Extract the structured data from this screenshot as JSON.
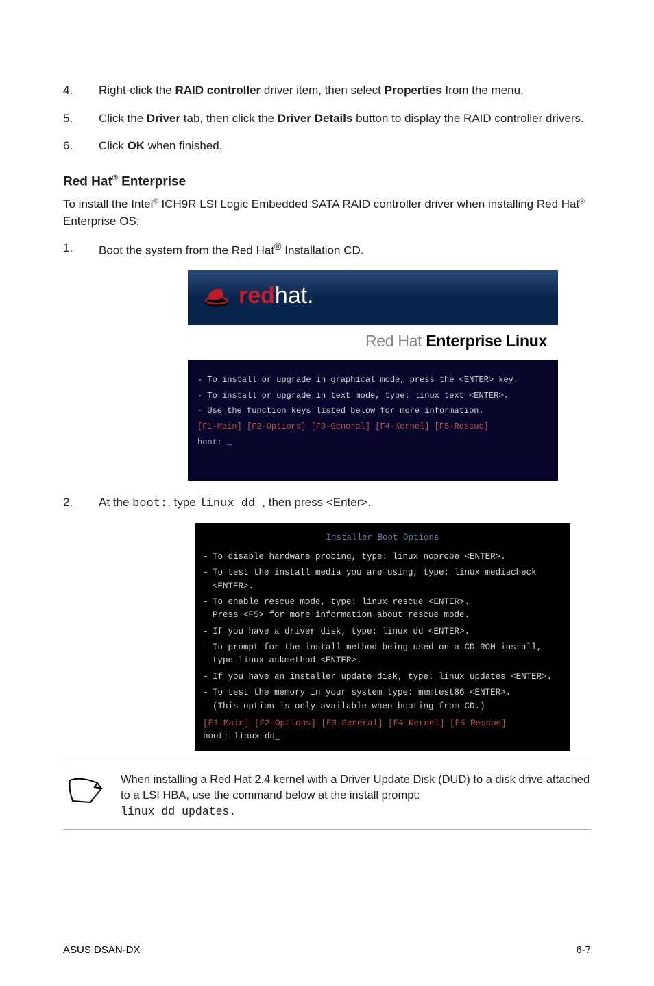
{
  "steps_a": [
    {
      "num": "4.",
      "html": "Right-click the <b>RAID controller</b> driver item, then select <b>Properties</b> from the menu."
    },
    {
      "num": "5.",
      "html": "Click the <b>Driver</b> tab, then click the <b>Driver Details</b> button to display the RAID controller drivers."
    },
    {
      "num": "6.",
      "html": "Click <b>OK</b> when finished."
    }
  ],
  "section_title": {
    "pre": "Red Hat",
    "sup": "®",
    "post": " Enterprise"
  },
  "intro": {
    "line1_pre": "To install the Intel",
    "line1_sup": "®",
    "line1_post": " ICH9R LSI Logic Embedded SATA RAID controller driver when installing Red Hat",
    "line2_sup": "®",
    "line2_post": " Enterprise OS:"
  },
  "steps_b": [
    {
      "num": "1.",
      "pre": "Boot the system from the Red Hat",
      "sup": "®",
      "post": " Installation CD."
    }
  ],
  "shot1": {
    "logo_red": "red",
    "logo_hat": "hat.",
    "subline_grey": "Red Hat ",
    "subline_bold": "Enterprise Linux",
    "console_lines": [
      "-  To install or upgrade in graphical mode, press the <ENTER> key.",
      "-  To install or upgrade in text mode, type: linux text <ENTER>.",
      "-  Use the function keys listed below for more information."
    ],
    "fkeys": "[F1-Main] [F2-Options] [F3-General] [F4-Kernel] [F5-Rescue]",
    "boot": "boot: _"
  },
  "step2": {
    "num": "2.",
    "pre": "At the ",
    "code1": "boot:",
    "mid": ", type ",
    "code2": "linux dd ",
    "post": ", then press <Enter>."
  },
  "shot2": {
    "title": "Installer Boot Options",
    "lines": [
      "To disable hardware probing, type: linux noprobe <ENTER>.",
      "To test the install media you are using, type: linux mediacheck <ENTER>.",
      "To enable rescue mode, type: linux rescue <ENTER>.\nPress <F5> for more information about rescue mode.",
      "If you have a driver disk, type: linux dd <ENTER>.",
      "To prompt for the install method being used on a CD-ROM install,\ntype linux askmethod <ENTER>.",
      "If you have an installer update disk, type: linux updates <ENTER>.",
      "To test the memory in your system type: memtest86 <ENTER>.\n(This option is only available when booting from CD.)"
    ],
    "fkeys": "[F1-Main] [F2-Options] [F3-General] [F4-Kernel] [F5-Rescue]",
    "boot": "boot: linux dd_"
  },
  "note": {
    "text_pre": "When installing a Red Hat 2.4 kernel with a Driver Update Disk (DUD) to a disk drive attached to a LSI HBA, use the command below at the install prompt:",
    "cmd": "linux dd updates."
  },
  "footer": {
    "left": "ASUS DSAN-DX",
    "right": "6-7"
  }
}
